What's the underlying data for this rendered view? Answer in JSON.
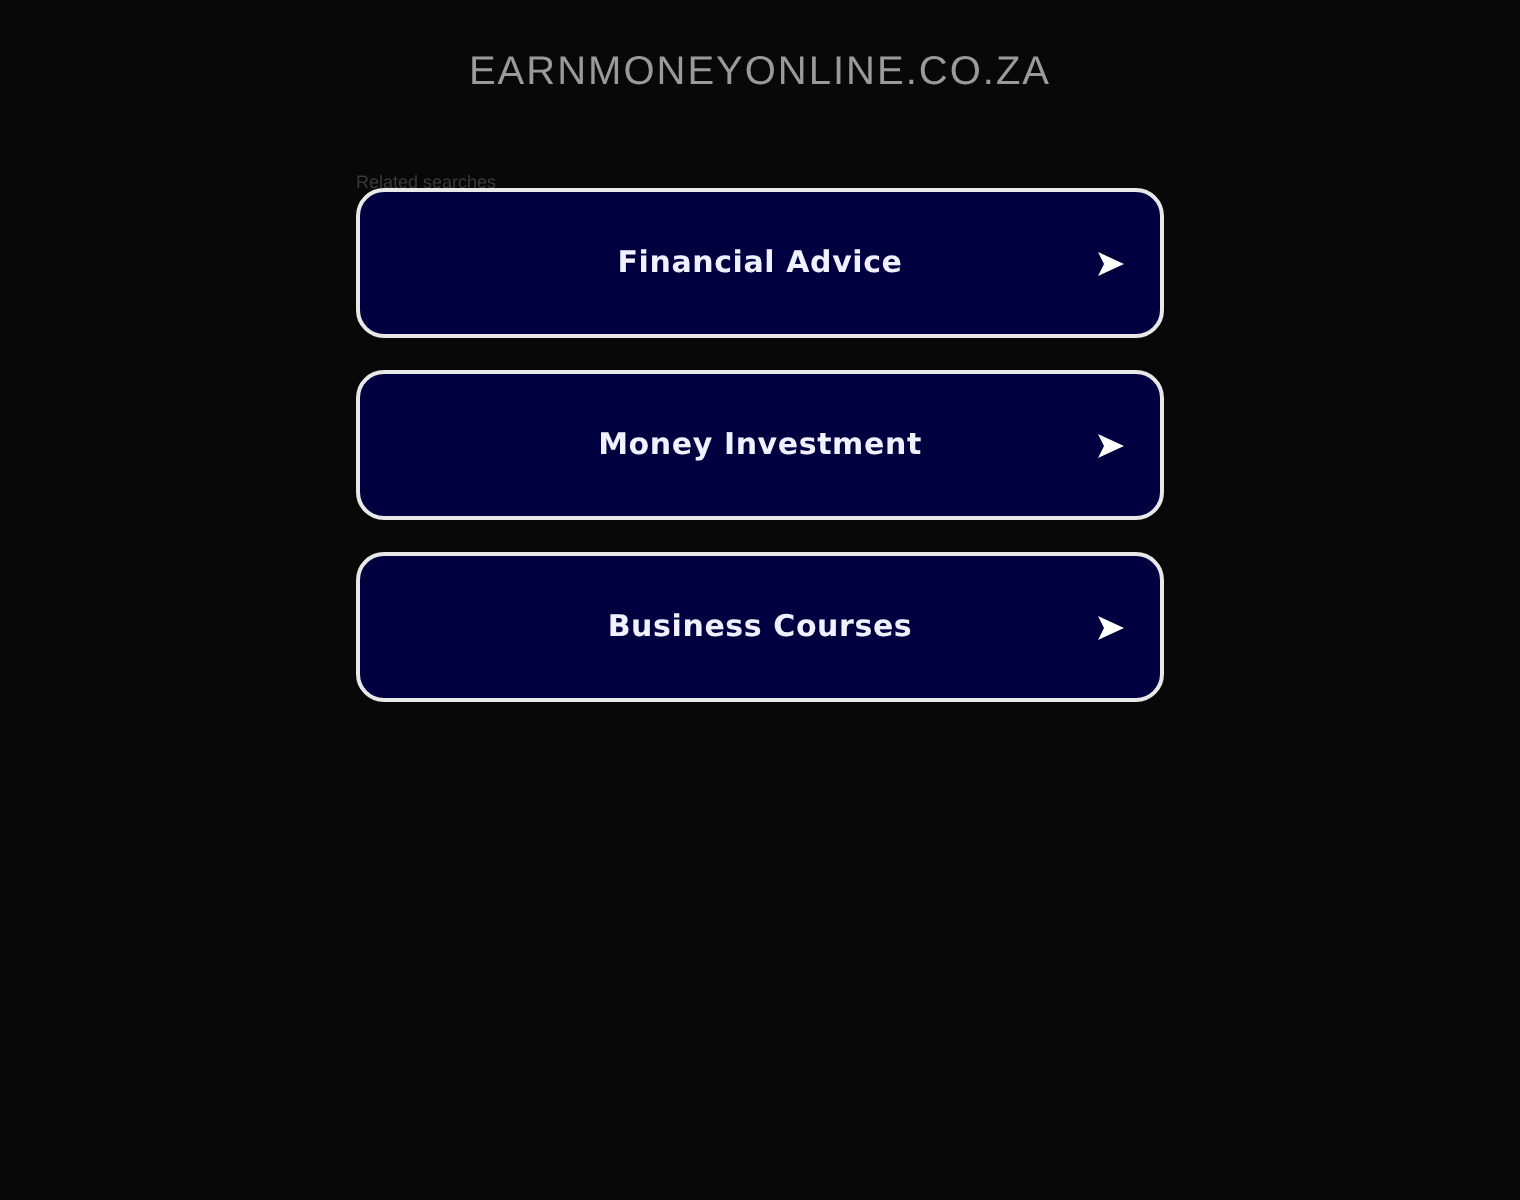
{
  "domain": "EARNMONEYONLINE.CO.ZA",
  "related": {
    "heading": "Related searches",
    "links": [
      {
        "label": "Financial Advice"
      },
      {
        "label": "Money Investment"
      },
      {
        "label": "Business Courses"
      }
    ]
  }
}
